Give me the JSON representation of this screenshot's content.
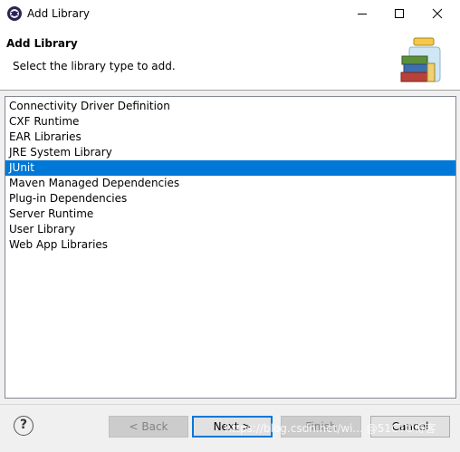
{
  "window": {
    "title": "Add Library",
    "icon": "eclipse-icon",
    "controls": [
      "minimize-icon",
      "maximize-icon",
      "close-icon"
    ]
  },
  "header": {
    "title": "Add Library",
    "description": "Select the library type to add.",
    "graphic": "library-jar-icon"
  },
  "library_list": {
    "items": [
      "Connectivity Driver Definition",
      "CXF Runtime",
      "EAR Libraries",
      "JRE System Library",
      "JUnit",
      "Maven Managed Dependencies",
      "Plug-in Dependencies",
      "Server Runtime",
      "User Library",
      "Web App Libraries"
    ],
    "selected": "JUnit"
  },
  "buttons": {
    "help": "?",
    "back": "< Back",
    "next": "Next >",
    "finish": "Finish",
    "cancel": "Cancel"
  },
  "watermark": "https://blog.csdn.net/wi... @51CTO博客",
  "colors": {
    "selection": "#0078d7",
    "default_button_border": "#0078d7"
  }
}
